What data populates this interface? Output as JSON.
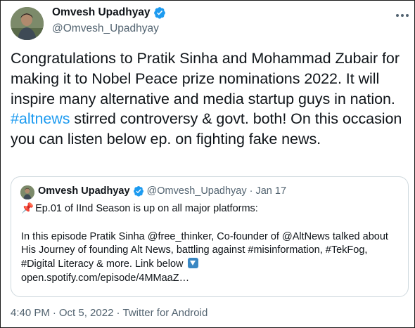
{
  "tweet": {
    "author": {
      "name": "Omvesh Upadhyay",
      "handle": "@Omvesh_Upadhyay",
      "verified": true,
      "avatar_icon": "user-avatar-photo"
    },
    "text": {
      "part1": "Congratulations to Pratik Sinha and Mohammad Zubair for making it to Nobel Peace prize nominations 2022. It will inspire many alternative and media startup guys in nation. ",
      "hashtag": "#altnews",
      "part2": " stirred controversy & govt. both! On this occasion you can listen below ep. on fighting fake news."
    },
    "time": "4:40 PM",
    "date": "Oct 5, 2022",
    "source": "Twitter for Android",
    "separator": "·",
    "more_icon": "more-options-icon"
  },
  "quoted": {
    "author": {
      "name": "Omvesh Upadhyay",
      "handle": "@Omvesh_Upadhyay",
      "verified": true
    },
    "separator": "·",
    "date": "Jan 17",
    "pin_emoji": "📌",
    "line1": "Ep.01 of IInd Season is up on all major platforms:",
    "line2": "In this episode Pratik Sinha @free_thinker, Co-founder of @AltNews talked about",
    "line3": "His Journey of founding Alt News,  battling against #misinformation, #TekFog,",
    "line4": "#Digital Literacy & more. Link below ",
    "line5": "open.spotify.com/episode/4MMaaZ…",
    "arrow_icon": "down-arrow-emoji"
  },
  "colors": {
    "link": "#1d9bf0",
    "text": "#0f1419",
    "secondary": "#536471",
    "verified": "#1d9bf0",
    "border": "#cfd9de"
  }
}
